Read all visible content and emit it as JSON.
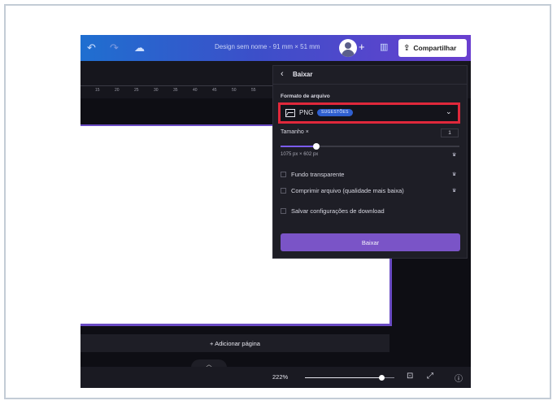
{
  "topbar": {
    "undo_icon": "undo-icon",
    "redo_icon": "redo-icon",
    "cloud_icon": "cloud-sync-icon",
    "title": "Design sem nome - 91 mm × 51 mm",
    "plus": "+",
    "share_label": "Compartilhar"
  },
  "ruler": {
    "ticks": [
      "15",
      "20",
      "25",
      "30",
      "35",
      "40",
      "45",
      "50",
      "55"
    ]
  },
  "panel": {
    "title": "Baixar",
    "format_section_label": "Formato de arquivo",
    "format_value": "PNG",
    "format_badge": "SUGESTÕES",
    "size_label": "Tamanho ×",
    "size_value": "1",
    "size_fraction": 0.2,
    "dimensions": "1075 px × 602 px",
    "options": [
      {
        "label": "Fundo transparente",
        "checked": false,
        "premium": true
      },
      {
        "label": "Comprimir arquivo (qualidade mais baixa)",
        "checked": false,
        "premium": true
      },
      {
        "label": "Salvar configurações de download",
        "checked": false,
        "premium": false
      }
    ],
    "download_button": "Baixar"
  },
  "canvas": {
    "add_page_label": "+ Adicionar página"
  },
  "bottombar": {
    "zoom": "222%",
    "zoom_fraction": 0.85
  },
  "colors": {
    "highlight": "#e0283b",
    "accent": "#7a54c7",
    "badge": "#2f5fd0"
  }
}
